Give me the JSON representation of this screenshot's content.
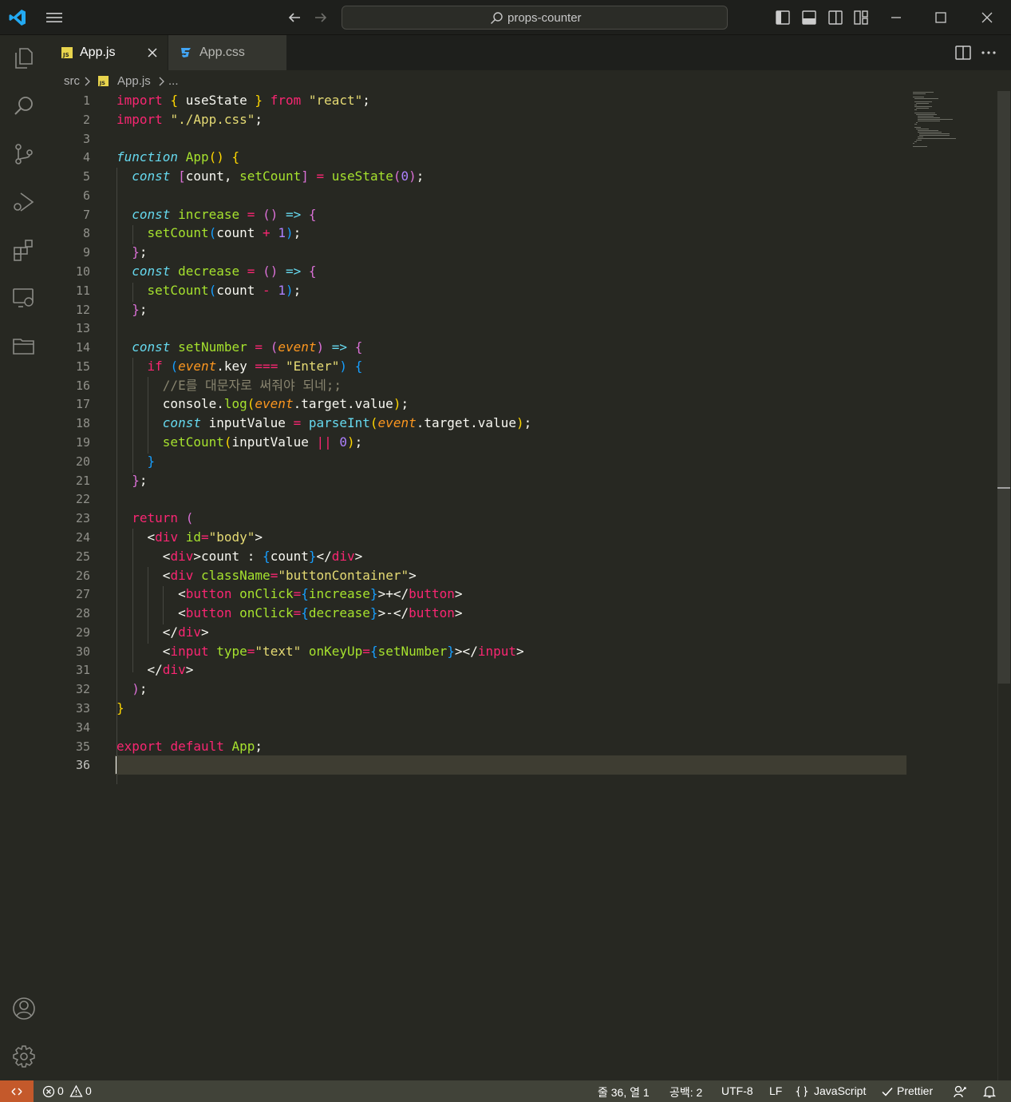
{
  "titlebar": {
    "search_text": "props-counter"
  },
  "tabs": [
    {
      "label": "App.js",
      "icon": "js-file-icon",
      "active": true
    },
    {
      "label": "App.css",
      "icon": "css-file-icon",
      "active": false
    }
  ],
  "breadcrumb": {
    "folder": "src",
    "file": "App.js",
    "more": "..."
  },
  "editor": {
    "line_numbers": [
      "1",
      "2",
      "3",
      "4",
      "5",
      "6",
      "7",
      "8",
      "9",
      "10",
      "11",
      "12",
      "13",
      "14",
      "15",
      "16",
      "17",
      "18",
      "19",
      "20",
      "21",
      "22",
      "23",
      "24",
      "25",
      "26",
      "27",
      "28",
      "29",
      "30",
      "31",
      "32",
      "33",
      "34",
      "35",
      "36"
    ],
    "current_line": 36
  },
  "statusbar": {
    "errors": "0",
    "warnings": "0",
    "position": "줄 36, 열 1",
    "indent": "공백: 2",
    "encoding": "UTF-8",
    "eol": "LF",
    "language": "JavaScript",
    "formatter": "Prettier",
    "accent_color": "#c4592b"
  },
  "theme": {
    "background": "#272822",
    "keyword": "#f92672",
    "string": "#e6db74",
    "function": "#a6e22e",
    "storage": "#66d9ef",
    "number": "#ae81ff"
  }
}
